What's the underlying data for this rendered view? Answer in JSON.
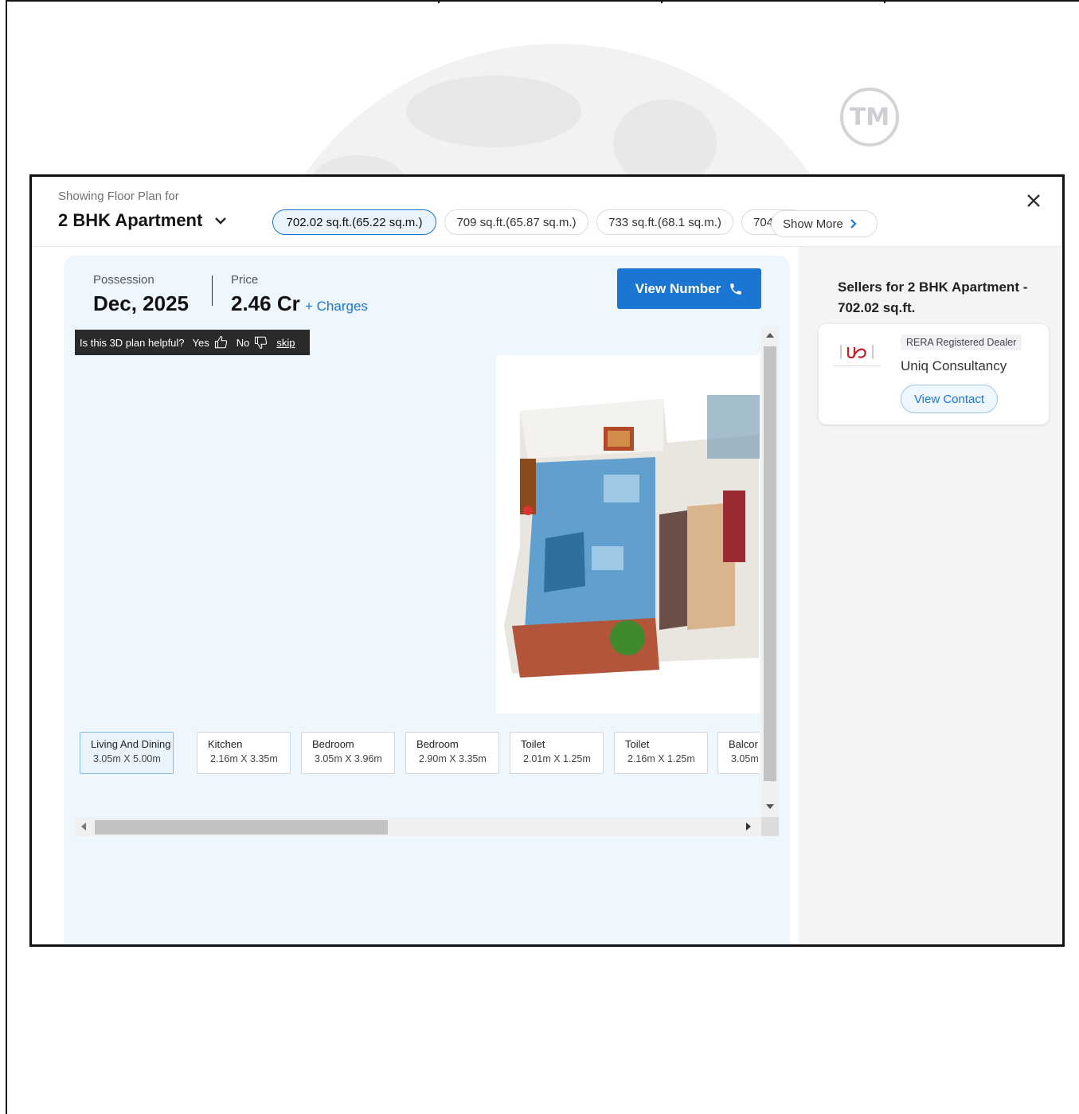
{
  "background": {
    "tm_mark": "TM"
  },
  "modal": {
    "showing_label": "Showing Floor Plan for",
    "config_title": "2 BHK Apartment",
    "size_options": [
      {
        "label": "702.02 sq.ft.(65.22 sq.m.)",
        "active": true
      },
      {
        "label": "709 sq.ft.(65.87 sq.m.)",
        "active": false
      },
      {
        "label": "733 sq.ft.(68.1 sq.m.)",
        "active": false
      },
      {
        "label": "704",
        "active": false
      }
    ],
    "show_more_label": "Show More"
  },
  "summary": {
    "possession_label": "Possession",
    "possession_value": "Dec, 2025",
    "price_label": "Price",
    "price_value": "2.46 Cr",
    "charges_link": "+ Charges",
    "view_number_label": "View Number"
  },
  "feedback": {
    "question": "Is this 3D plan helpful?",
    "yes": "Yes",
    "no": "No",
    "skip": "skip"
  },
  "rooms": [
    {
      "name": "Living And Dining",
      "dims": "3.05m X 5.00m",
      "active": true
    },
    {
      "name": "Kitchen",
      "dims": "2.16m X 3.35m",
      "active": false
    },
    {
      "name": "Bedroom",
      "dims": "3.05m X 3.96m",
      "active": false
    },
    {
      "name": "Bedroom",
      "dims": "2.90m X 3.35m",
      "active": false
    },
    {
      "name": "Toilet",
      "dims": "2.01m X 1.25m",
      "active": false
    },
    {
      "name": "Toilet",
      "dims": "2.16m X 1.25m",
      "active": false
    },
    {
      "name": "Balcor",
      "dims": "3.05m",
      "active": false
    }
  ],
  "sellers": {
    "title": "Sellers for 2 BHK Apartment - 702.02 sq.ft.",
    "items": [
      {
        "badge": "RERA Registered Dealer",
        "name": "Uniq Consultancy",
        "contact_label": "View Contact"
      }
    ]
  },
  "colors": {
    "accent": "#1a76d2",
    "panel_bg": "#eef6fe",
    "side_bg": "#f3f4f6"
  }
}
